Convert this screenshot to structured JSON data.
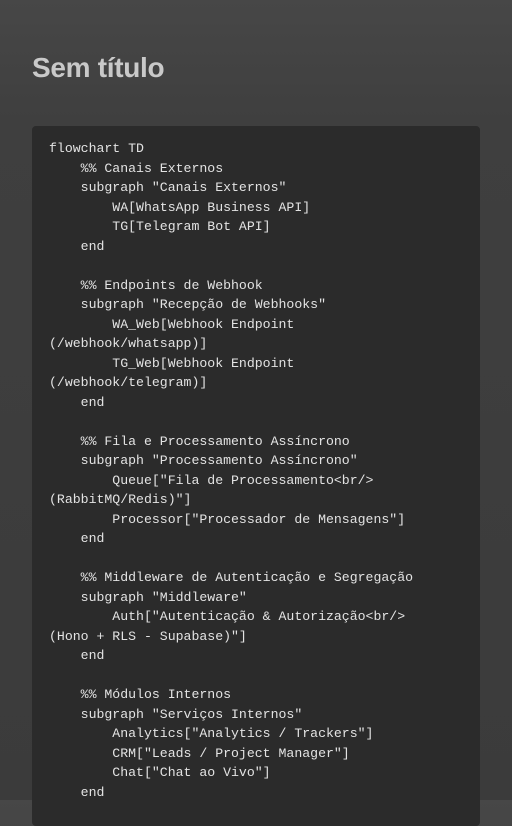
{
  "page": {
    "title": "Sem título"
  },
  "code": {
    "lines": [
      "flowchart TD",
      "    %% Canais Externos",
      "    subgraph \"Canais Externos\"",
      "        WA[WhatsApp Business API]",
      "        TG[Telegram Bot API]",
      "    end",
      "",
      "    %% Endpoints de Webhook",
      "    subgraph \"Recepção de Webhooks\"",
      "        WA_Web[Webhook Endpoint",
      "(/webhook/whatsapp)]",
      "        TG_Web[Webhook Endpoint",
      "(/webhook/telegram)]",
      "    end",
      "",
      "    %% Fila e Processamento Assíncrono",
      "    subgraph \"Processamento Assíncrono\"",
      "        Queue[\"Fila de Processamento<br/>",
      "(RabbitMQ/Redis)\"]",
      "        Processor[\"Processador de Mensagens\"]",
      "    end",
      "",
      "    %% Middleware de Autenticação e Segregação",
      "    subgraph \"Middleware\"",
      "        Auth[\"Autenticação & Autorização<br/>",
      "(Hono + RLS - Supabase)\"]",
      "    end",
      "",
      "    %% Módulos Internos",
      "    subgraph \"Serviços Internos\"",
      "        Analytics[\"Analytics / Trackers\"]",
      "        CRM[\"Leads / Project Manager\"]",
      "        Chat[\"Chat ao Vivo\"]",
      "    end"
    ]
  }
}
